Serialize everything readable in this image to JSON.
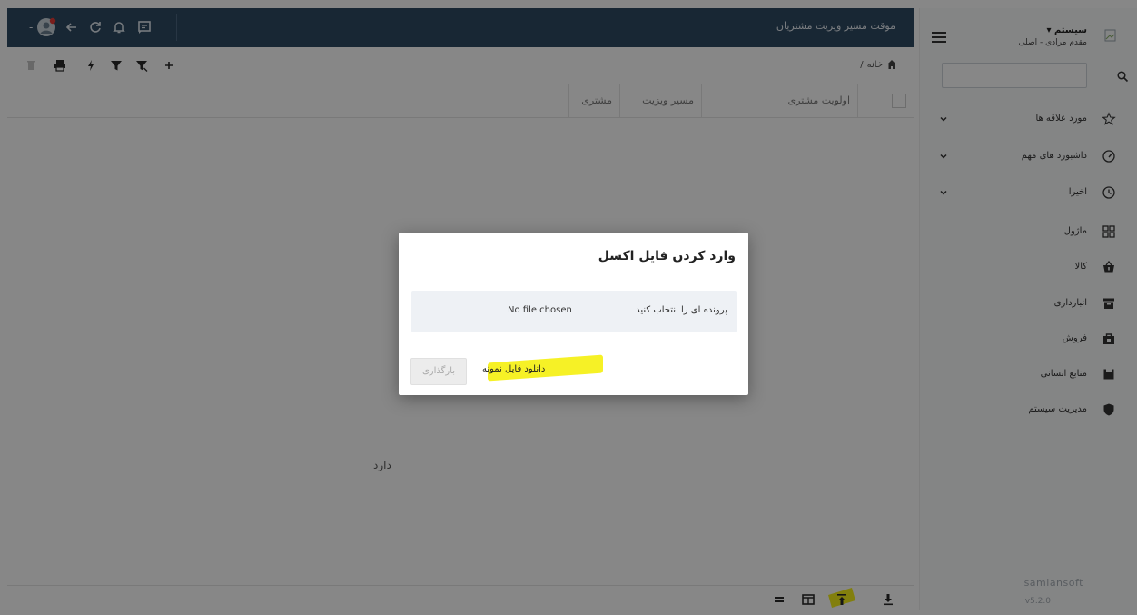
{
  "window": {
    "title": "موقت مسیر ویزیت مشتریان"
  },
  "breadcrumb": {
    "home": "خانه",
    "separator": "/"
  },
  "grid": {
    "columns": [
      "اولویت مشتری",
      "مسیر ویزیت",
      "مشتری"
    ],
    "empty_text_fragment": "دارد"
  },
  "sidebar": {
    "system_name": "سیستم ▾",
    "system_sub": "مقدم مرادی - اصلی",
    "search_placeholder": "",
    "items": [
      {
        "label": "مورد علاقه ها",
        "icon": "star-icon",
        "expandable": true
      },
      {
        "label": "داشبورد های مهم",
        "icon": "dashboard-icon",
        "expandable": true
      },
      {
        "label": "اخیرا",
        "icon": "clock-icon",
        "expandable": true
      },
      {
        "label": "ماژول",
        "icon": "modules-icon",
        "expandable": false
      },
      {
        "label": "کالا",
        "icon": "basket-icon",
        "expandable": false
      },
      {
        "label": "انبارداری",
        "icon": "archive-icon",
        "expandable": false
      },
      {
        "label": "فروش",
        "icon": "shop-icon",
        "expandable": false
      },
      {
        "label": "منابع انسانی",
        "icon": "floppy-icon",
        "expandable": false
      },
      {
        "label": "مدیریت سیستم",
        "icon": "shield-icon",
        "expandable": false
      }
    ],
    "brand": "samiansoft",
    "version": "v5.2.0"
  },
  "modal": {
    "title": "وارد کردن فایل اکسل",
    "file_label": "پرونده ای را انتخاب کنید",
    "file_status": "No file chosen",
    "sample_link": "دانلود فایل نمونه",
    "upload_button": "بارگذاری"
  },
  "colors": {
    "header_bg": "#2f4a62",
    "highlight": "#f5f01a",
    "notification_dot": "#e53935"
  }
}
